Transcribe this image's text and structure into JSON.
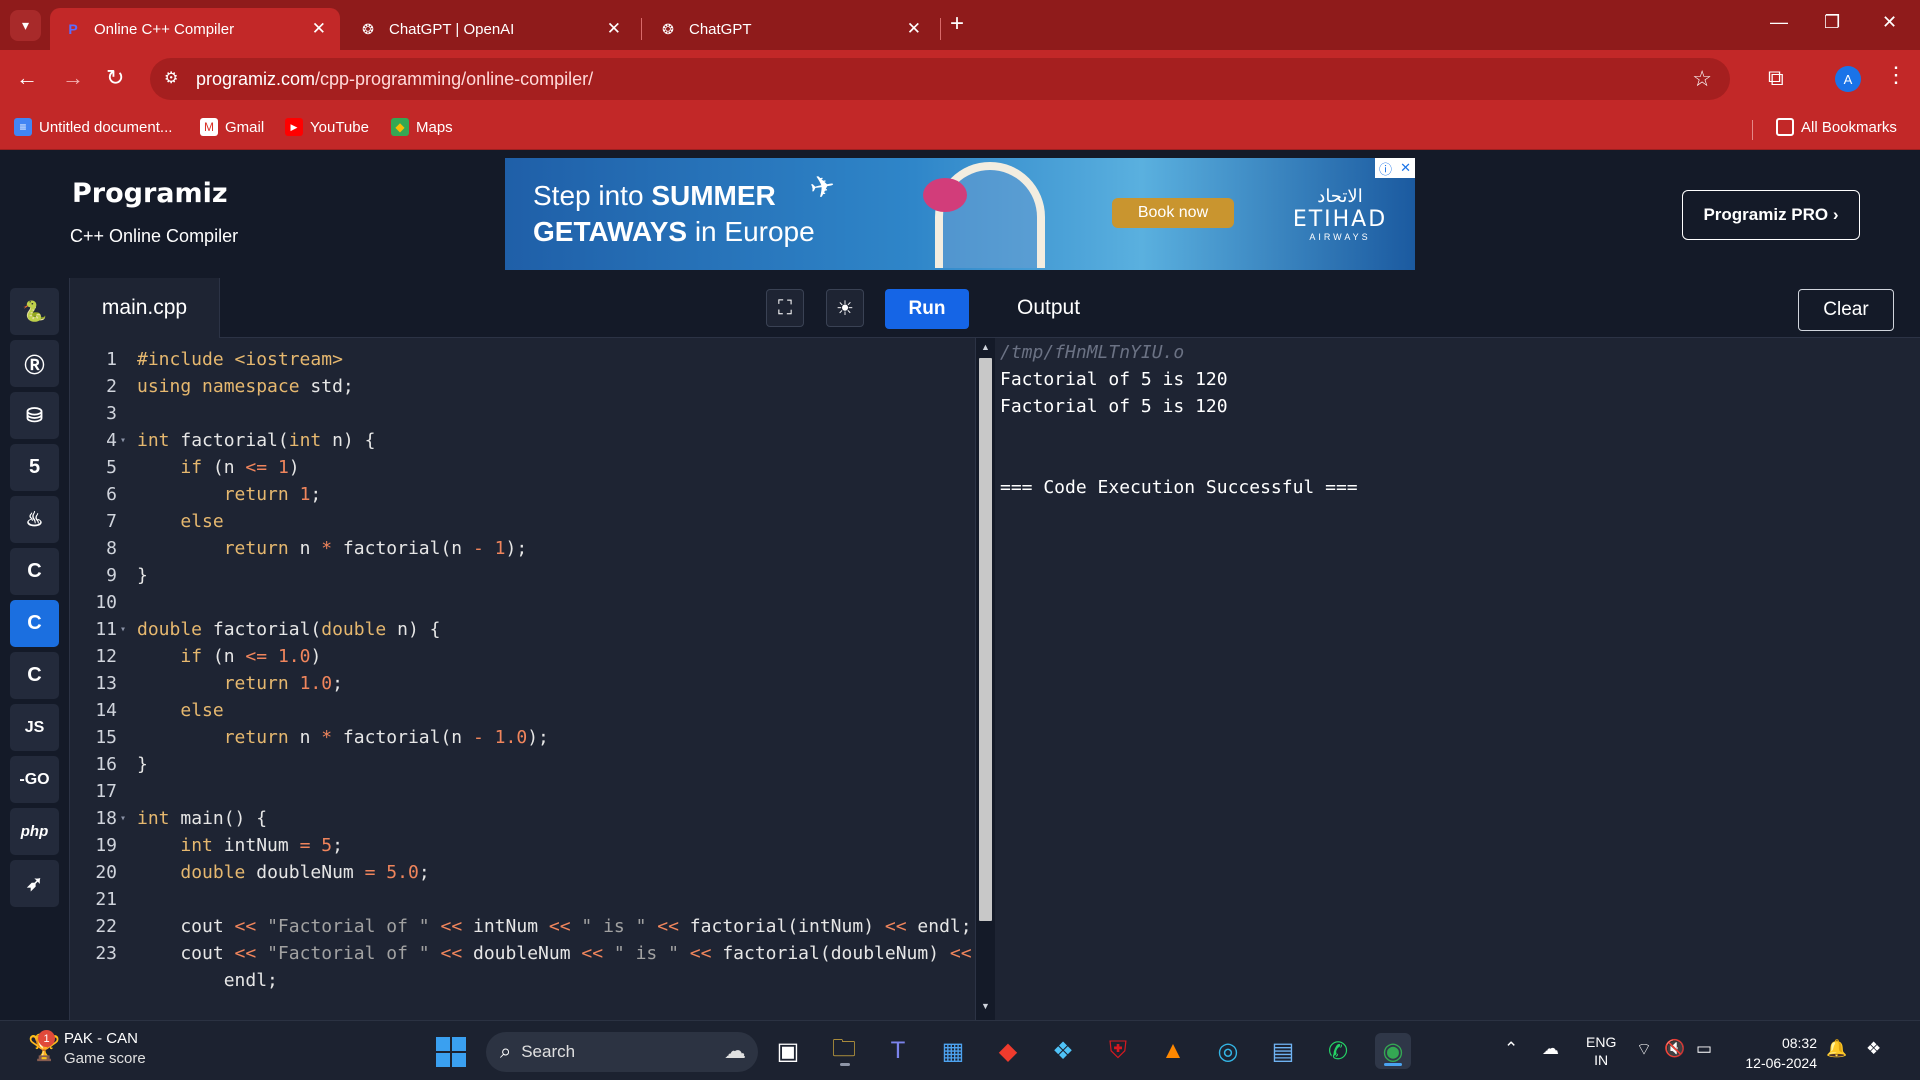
{
  "browser": {
    "tabs": [
      {
        "title": "Online C++ Compiler",
        "favicon": "programiz-favicon",
        "active": true
      },
      {
        "title": "ChatGPT | OpenAI",
        "favicon": "openai-favicon",
        "active": false
      },
      {
        "title": "ChatGPT",
        "favicon": "openai-favicon",
        "active": false
      }
    ],
    "url_host": "programiz.com",
    "url_path": "/cpp-programming/online-compiler/",
    "profile_initial": "A",
    "bookmarks": [
      "Untitled document...",
      "Gmail",
      "YouTube",
      "Maps"
    ],
    "all_bookmarks": "All Bookmarks",
    "colors": {
      "frame": "#8f1b1b",
      "toolbar": "#c22828"
    }
  },
  "header": {
    "logo": "Programiz",
    "subtitle": "C++ Online Compiler",
    "pro_button": "Programiz PRO ›"
  },
  "ad": {
    "line1_prefix": "Step into ",
    "line1_bold": "SUMMER",
    "line2_bold": "GETAWAYS",
    "line2_suffix": " in Europe",
    "cta": "Book now",
    "brand_ar": "الاتحاد",
    "brand_en": "ETIHAD",
    "brand_sub": "AIRWAYS"
  },
  "sidebar": {
    "languages": [
      "python",
      "r",
      "sql",
      "html",
      "java",
      "c",
      "cpp",
      "csharp",
      "js",
      "go",
      "php",
      "swift"
    ],
    "labels": {
      "js": "JS",
      "go": "-GO",
      "php": "php"
    },
    "active": "cpp",
    "accent": "#1b6fe0"
  },
  "editor": {
    "file_name": "main.cpp",
    "run_label": "Run",
    "lines": [
      "#include <iostream>",
      "using namespace std;",
      "",
      "int factorial(int n) {",
      "    if (n <= 1)",
      "        return 1;",
      "    else",
      "        return n * factorial(n - 1);",
      "}",
      "",
      "double factorial(double n) {",
      "    if (n <= 1.0)",
      "        return 1.0;",
      "    else",
      "        return n * factorial(n - 1.0);",
      "}",
      "",
      "int main() {",
      "    int intNum = 5;",
      "    double doubleNum = 5.0;",
      "",
      "    cout << \"Factorial of \" << intNum << \" is \" << factorial(intNum) << endl;",
      "    cout << \"Factorial of \" << doubleNum << \" is \" << factorial(doubleNum) <<",
      "        endl;"
    ],
    "line_numbers": [
      "1",
      "2",
      "3",
      "4",
      "5",
      "6",
      "7",
      "8",
      "9",
      "10",
      "11",
      "12",
      "13",
      "14",
      "15",
      "16",
      "17",
      "18",
      "19",
      "20",
      "21",
      "22",
      "23",
      ""
    ],
    "fold_lines": [
      4,
      11,
      18
    ]
  },
  "output": {
    "title": "Output",
    "clear_label": "Clear",
    "path": "/tmp/fHnMLTnYIU.o",
    "lines": [
      "Factorial of 5 is 120",
      "Factorial of 5 is 120",
      "",
      "",
      "=== Code Execution Successful ==="
    ]
  },
  "taskbar": {
    "weather_title": "PAK - CAN",
    "weather_sub": "Game score",
    "weather_badge": "1",
    "search_placeholder": "Search",
    "apps": [
      "task-view",
      "file-explorer",
      "teams",
      "microsoft-store",
      "anydesk",
      "copilot",
      "mcafee",
      "vlc",
      "edge",
      "dev-home",
      "whatsapp",
      "chrome"
    ],
    "lang_line1": "ENG",
    "lang_line2": "IN",
    "time": "08:32",
    "date": "12-06-2024"
  }
}
